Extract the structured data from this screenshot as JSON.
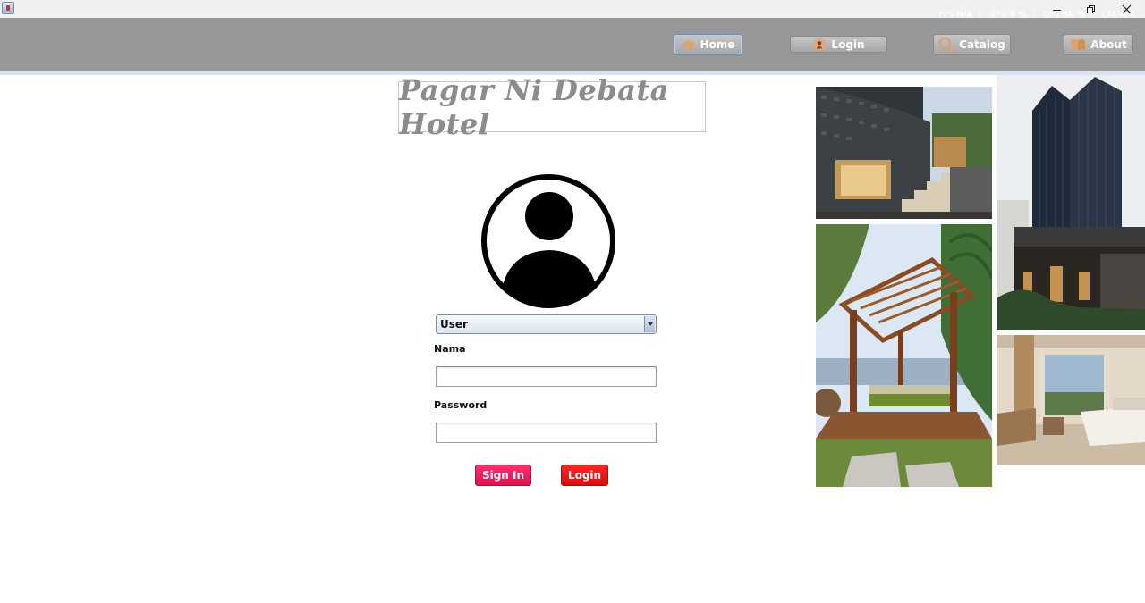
{
  "window": {
    "perf": {
      "fps_label": "FPS",
      "fps": "N/A",
      "gpu_label": "GPU",
      "gpu": "0 %",
      "cpu_label": "CPU",
      "cpu": "30 %",
      "lat_label": "LAT",
      "lat": "N/A"
    }
  },
  "nav": {
    "home": "Home",
    "login": "Login",
    "catalog": "Catalog",
    "about": "About"
  },
  "hotel": {
    "title": "Pagar Ni Debata Hotel"
  },
  "form": {
    "role_selected": "User",
    "nama_label": "Nama",
    "nama_value": "",
    "password_label": "Password",
    "password_value": "",
    "signin_button": "Sign In",
    "login_button": "Login"
  },
  "colors": {
    "header_bg": "#989898",
    "signin_bg": "#e8195a",
    "login_bg": "#ee1515",
    "title_text": "#8c8c8c"
  },
  "icons": {
    "home": "home-icon",
    "login": "user-icon",
    "catalog": "search-icon",
    "about": "book-icon",
    "avatar": "user-avatar-icon"
  }
}
